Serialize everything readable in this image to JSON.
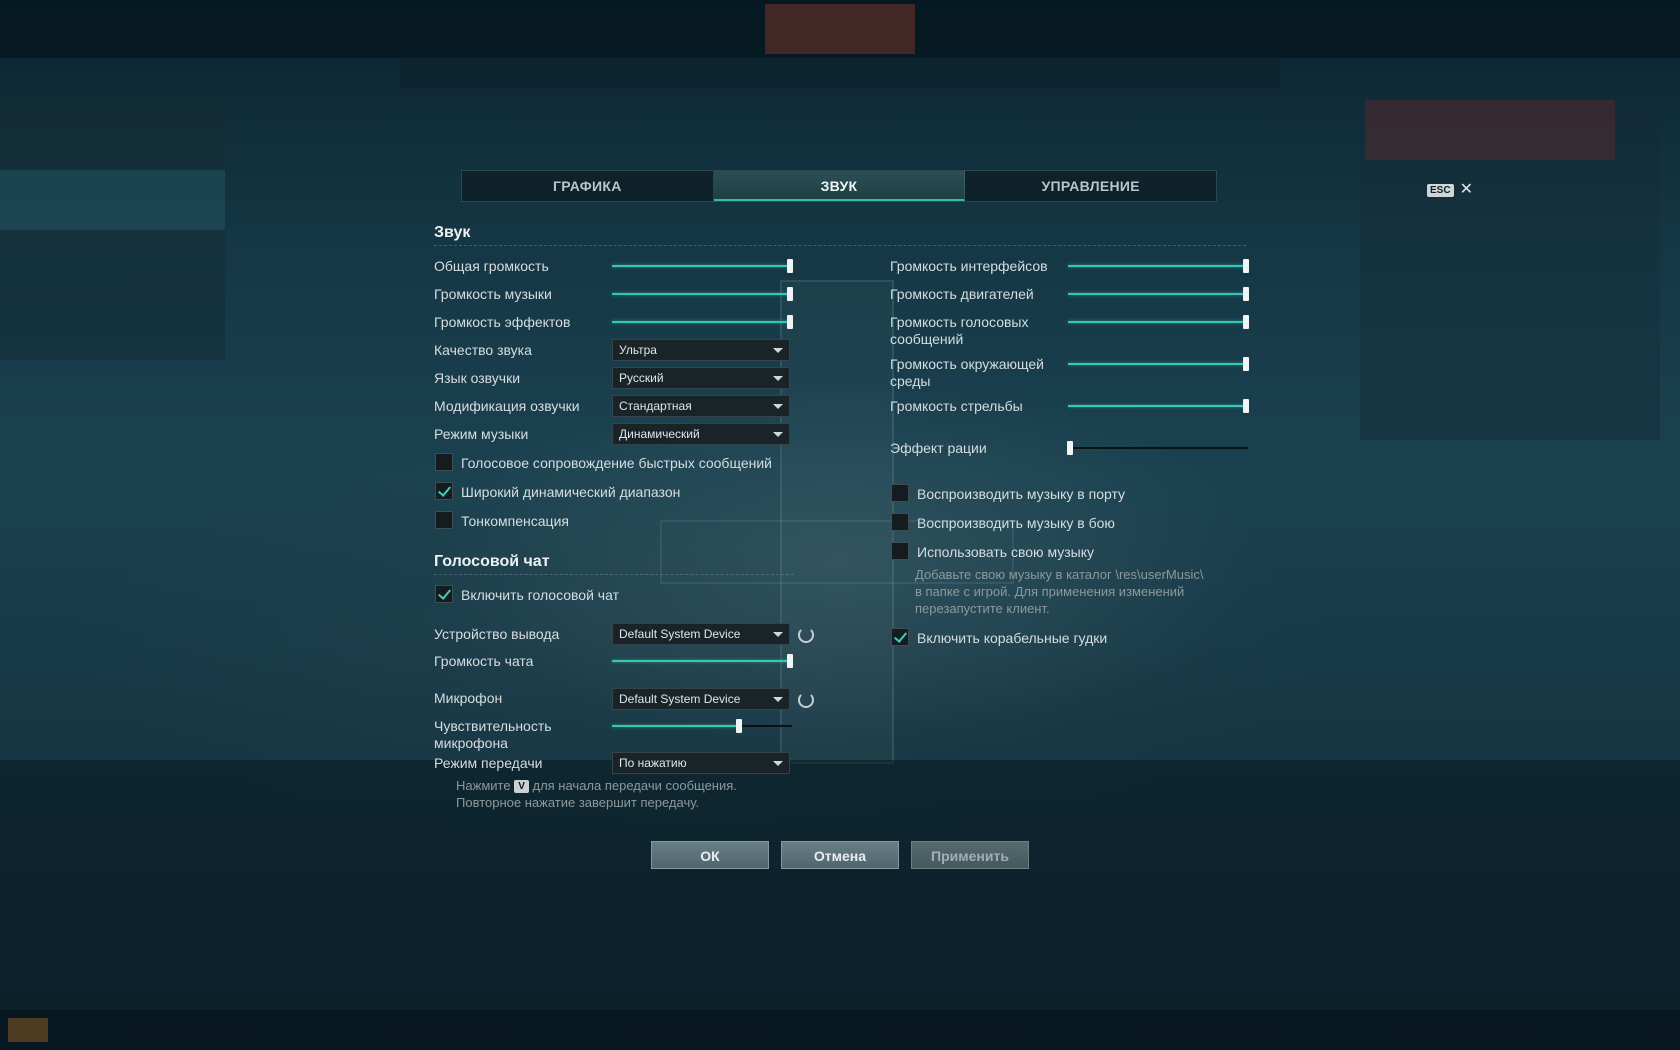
{
  "tabs": {
    "graphics": "ГРАФИКА",
    "sound": "ЗВУК",
    "controls": "УПРАВЛЕНИЕ"
  },
  "esc": {
    "key": "ESC",
    "close": "✕"
  },
  "sound": {
    "title": "Звук",
    "master_volume": {
      "label": "Общая громкость",
      "value": 1.0
    },
    "music_volume": {
      "label": "Громкость музыки",
      "value": 1.0
    },
    "effects_volume": {
      "label": "Громкость эффектов",
      "value": 1.0
    },
    "quality": {
      "label": "Качество звука",
      "value": "Ультра"
    },
    "voice_language": {
      "label": "Язык озвучки",
      "value": "Русский"
    },
    "voice_mod": {
      "label": "Модификация озвучки",
      "value": "Стандартная"
    },
    "music_mode": {
      "label": "Режим музыки",
      "value": "Динамический"
    },
    "quick_messages_voice": {
      "label": "Голосовое сопровождение быстрых сообщений",
      "checked": false
    },
    "wide_dynamic_range": {
      "label": "Широкий динамический диапазон",
      "checked": true
    },
    "tone_compensation": {
      "label": "Тонкомпенсация",
      "checked": false
    },
    "interface_volume": {
      "label": "Громкость интерфейсов",
      "value": 1.0
    },
    "engine_volume": {
      "label": "Громкость двигателей",
      "value": 1.0
    },
    "voice_messages_volume": {
      "label_line1": "Громкость голосовых",
      "label_line2": "сообщений",
      "value": 1.0
    },
    "ambient_volume": {
      "label_line1": "Громкость окружающей",
      "label_line2": "среды",
      "value": 1.0
    },
    "shooting_volume": {
      "label": "Громкость стрельбы",
      "value": 1.0
    },
    "radio_effect": {
      "label": "Эффект рации",
      "value": 0.0
    },
    "music_in_port": {
      "label": "Воспроизводить музыку в порту",
      "checked": false
    },
    "music_in_battle": {
      "label": "Воспроизводить музыку в бою",
      "checked": false
    },
    "own_music": {
      "label": "Использовать свою музыку",
      "checked": false
    },
    "own_music_hint": {
      "line1": "Добавьте свою музыку в каталог \\res\\userMusic\\",
      "line2": "в папке с игрой. Для применения изменений",
      "line3": "перезапустите клиент."
    },
    "ship_horns": {
      "label": "Включить корабельные гудки",
      "checked": true
    }
  },
  "voice_chat": {
    "title": "Голосовой чат",
    "enable": {
      "label": "Включить голосовой чат",
      "checked": true
    },
    "output_device": {
      "label": "Устройство вывода",
      "value": "Default System Device"
    },
    "chat_volume": {
      "label": "Громкость чата",
      "value": 1.0
    },
    "microphone": {
      "label": "Микрофон",
      "value": "Default System Device"
    },
    "mic_sensitivity": {
      "label_line1": "Чувствительность",
      "label_line2": "микрофона",
      "value": 0.71
    },
    "transmit_mode": {
      "label": "Режим передачи",
      "value": "По нажатию"
    },
    "hint": {
      "before_key": "Нажмите",
      "key": "V",
      "after_key": "для начала передачи сообщения.",
      "line2": "Повторное нажатие завершит передачу."
    }
  },
  "buttons": {
    "ok": "ОК",
    "cancel": "Отмена",
    "apply": "Применить"
  },
  "colors": {
    "accent": "#36c8b1",
    "check": "#3fd0b6"
  }
}
